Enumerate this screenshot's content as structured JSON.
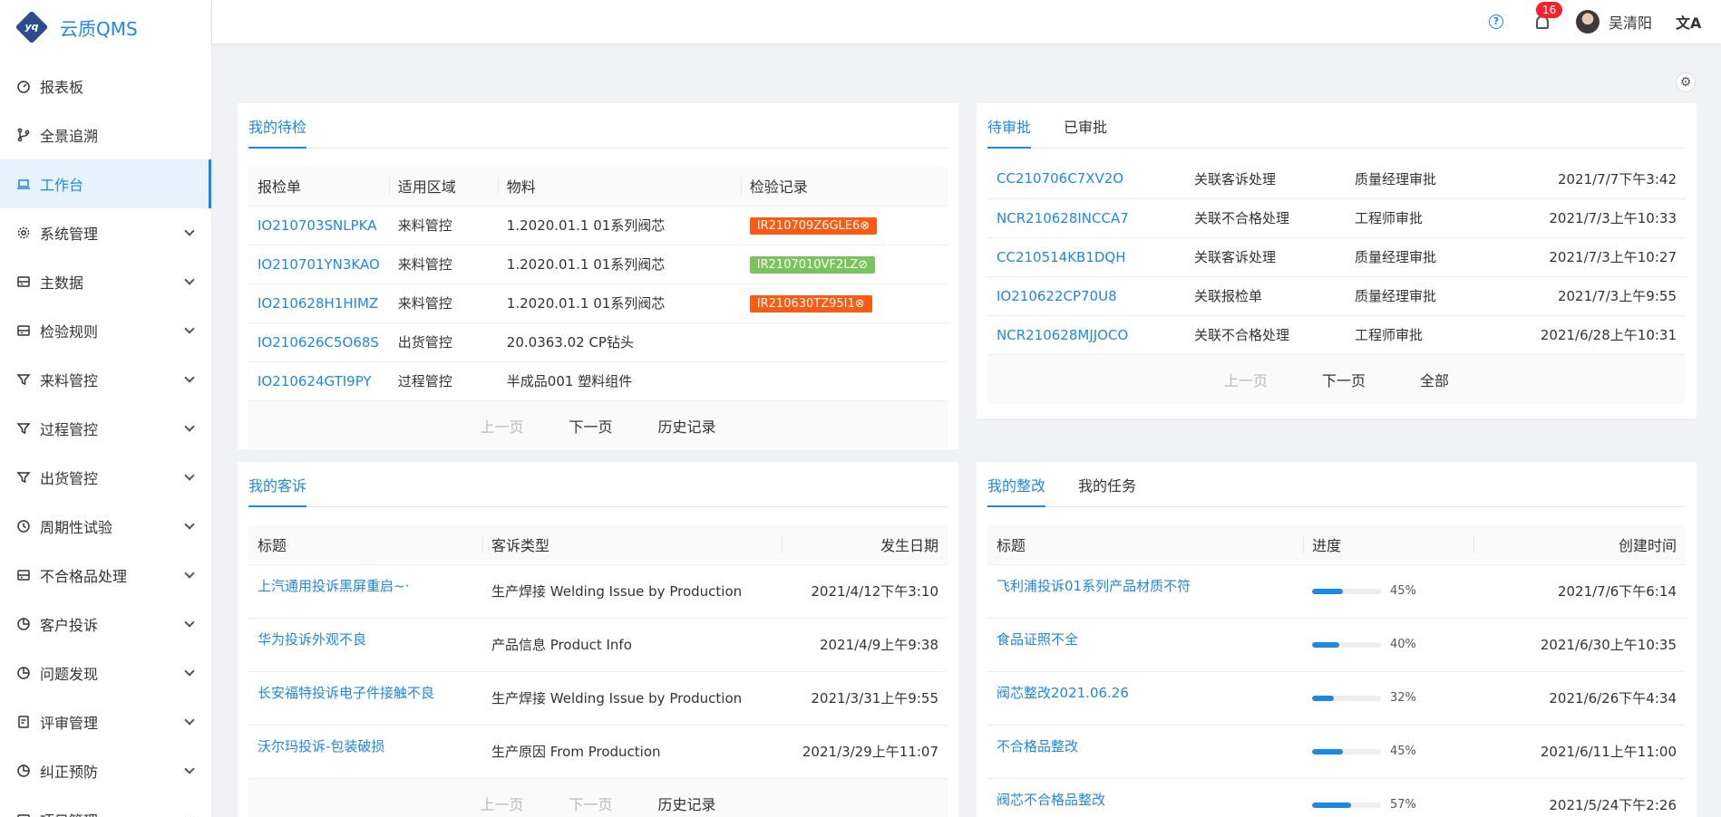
{
  "app": {
    "logo_mark": "yq",
    "title": "云质QMS"
  },
  "sidebar": {
    "items": [
      {
        "label": "报表板",
        "icon": "dashboard-icon",
        "active": false,
        "expandable": false
      },
      {
        "label": "全景追溯",
        "icon": "branch-icon",
        "active": false,
        "expandable": false
      },
      {
        "label": "工作台",
        "icon": "laptop-icon",
        "active": true,
        "expandable": false
      },
      {
        "label": "系统管理",
        "icon": "gear-icon",
        "active": false,
        "expandable": true
      },
      {
        "label": "主数据",
        "icon": "database-icon",
        "active": false,
        "expandable": true
      },
      {
        "label": "检验规则",
        "icon": "database-icon",
        "active": false,
        "expandable": true
      },
      {
        "label": "来料管控",
        "icon": "filter-icon",
        "active": false,
        "expandable": true
      },
      {
        "label": "过程管控",
        "icon": "filter-icon",
        "active": false,
        "expandable": true
      },
      {
        "label": "出货管控",
        "icon": "filter-icon",
        "active": false,
        "expandable": true
      },
      {
        "label": "周期性试验",
        "icon": "clock-icon",
        "active": false,
        "expandable": true
      },
      {
        "label": "不合格品处理",
        "icon": "database-icon",
        "active": false,
        "expandable": true
      },
      {
        "label": "客户投诉",
        "icon": "pie-icon",
        "active": false,
        "expandable": true
      },
      {
        "label": "问题发现",
        "icon": "pie-icon",
        "active": false,
        "expandable": true
      },
      {
        "label": "评审管理",
        "icon": "audit-icon",
        "active": false,
        "expandable": true
      },
      {
        "label": "纠正预防",
        "icon": "pie-icon",
        "active": false,
        "expandable": true
      },
      {
        "label": "项目管理",
        "icon": "database-icon",
        "active": false,
        "expandable": true
      }
    ]
  },
  "header": {
    "help": "?",
    "notifications": "16",
    "user_name": "吴清阳",
    "lang": "文A"
  },
  "pending_inspection": {
    "tab": "我的待检",
    "headers": [
      "报检单",
      "适用区域",
      "物料",
      "检验记录"
    ],
    "rows": [
      {
        "no": "IO210703SNLPKA",
        "area": "来料管控",
        "material": "1.2020.01.1 01系列阀芯",
        "record": "IR210709Z6GLE6⊗",
        "status": "fail"
      },
      {
        "no": "IO210701YN3KAO",
        "area": "来料管控",
        "material": "1.2020.01.1 01系列阀芯",
        "record": "IR2107010VF2LZ⊘",
        "status": "pass"
      },
      {
        "no": "IO210628H1HIMZ",
        "area": "来料管控",
        "material": "1.2020.01.1 01系列阀芯",
        "record": "IR210630TZ95I1⊗",
        "status": "fail"
      },
      {
        "no": "IO210626C5O68S",
        "area": "出货管控",
        "material": "20.0363.02 CP钻头",
        "record": "",
        "status": ""
      },
      {
        "no": "IO210624GTI9PY",
        "area": "过程管控",
        "material": "半成品001 塑料组件",
        "record": "",
        "status": ""
      }
    ],
    "pager": {
      "prev": "上一页",
      "next": "下一页",
      "history": "历史记录"
    }
  },
  "approvals": {
    "tabs": [
      "待审批",
      "已审批"
    ],
    "rows": [
      {
        "no": "CC210706C7XV2O",
        "type": "关联客诉处理",
        "step": "质量经理审批",
        "time": "2021/7/7下午3:42"
      },
      {
        "no": "NCR210628INCCA7",
        "type": "关联不合格处理",
        "step": "工程师审批",
        "time": "2021/7/3上午10:33"
      },
      {
        "no": "CC210514KB1DQH",
        "type": "关联客诉处理",
        "step": "质量经理审批",
        "time": "2021/7/3上午10:27"
      },
      {
        "no": "IO210622CP70U8",
        "type": "关联报检单",
        "step": "质量经理审批",
        "time": "2021/7/3上午9:55"
      },
      {
        "no": "NCR210628MJJOCO",
        "type": "关联不合格处理",
        "step": "工程师审批",
        "time": "2021/6/28上午10:31"
      }
    ],
    "pager": {
      "prev": "上一页",
      "next": "下一页",
      "all": "全部"
    }
  },
  "complaints": {
    "tab": "我的客诉",
    "headers": [
      "标题",
      "客诉类型",
      "发生日期"
    ],
    "rows": [
      {
        "title": "上汽通用投诉黑屏重启~·",
        "type": "生产焊接 Welding Issue by Production",
        "date": "2021/4/12下午3:10"
      },
      {
        "title": "华为投诉外观不良",
        "type": "产品信息 Product Info",
        "date": "2021/4/9上午9:38"
      },
      {
        "title": "长安福特投诉电子件接触不良",
        "type": "生产焊接 Welding Issue by Production",
        "date": "2021/3/31上午9:55"
      },
      {
        "title": "沃尔玛投诉-包装破损",
        "type": "生产原因 From Production",
        "date": "2021/3/29上午11:07"
      }
    ],
    "pager": {
      "prev": "上一页",
      "next": "下一页",
      "history": "历史记录"
    }
  },
  "rectifications": {
    "tabs": [
      "我的整改",
      "我的任务"
    ],
    "headers": [
      "标题",
      "进度",
      "创建时间"
    ],
    "rows": [
      {
        "title": "飞利浦投诉01系列产品材质不符",
        "progress": 45,
        "progress_label": "45%",
        "time": "2021/7/6下午6:14"
      },
      {
        "title": "食品证照不全",
        "progress": 40,
        "progress_label": "40%",
        "time": "2021/6/30上午10:35"
      },
      {
        "title": "阀芯整改2021.06.26",
        "progress": 32,
        "progress_label": "32%",
        "time": "2021/6/26下午4:34"
      },
      {
        "title": "不合格品整改",
        "progress": 45,
        "progress_label": "45%",
        "time": "2021/6/11上午11:00"
      },
      {
        "title": "阀芯不合格品整改",
        "progress": 57,
        "progress_label": "57%",
        "time": "2021/5/24下午2:26"
      }
    ]
  },
  "colors": {
    "accent": "#1e88e5",
    "fail": "#ff5a14",
    "pass": "#7ac45d",
    "badge": "#f5222d"
  }
}
